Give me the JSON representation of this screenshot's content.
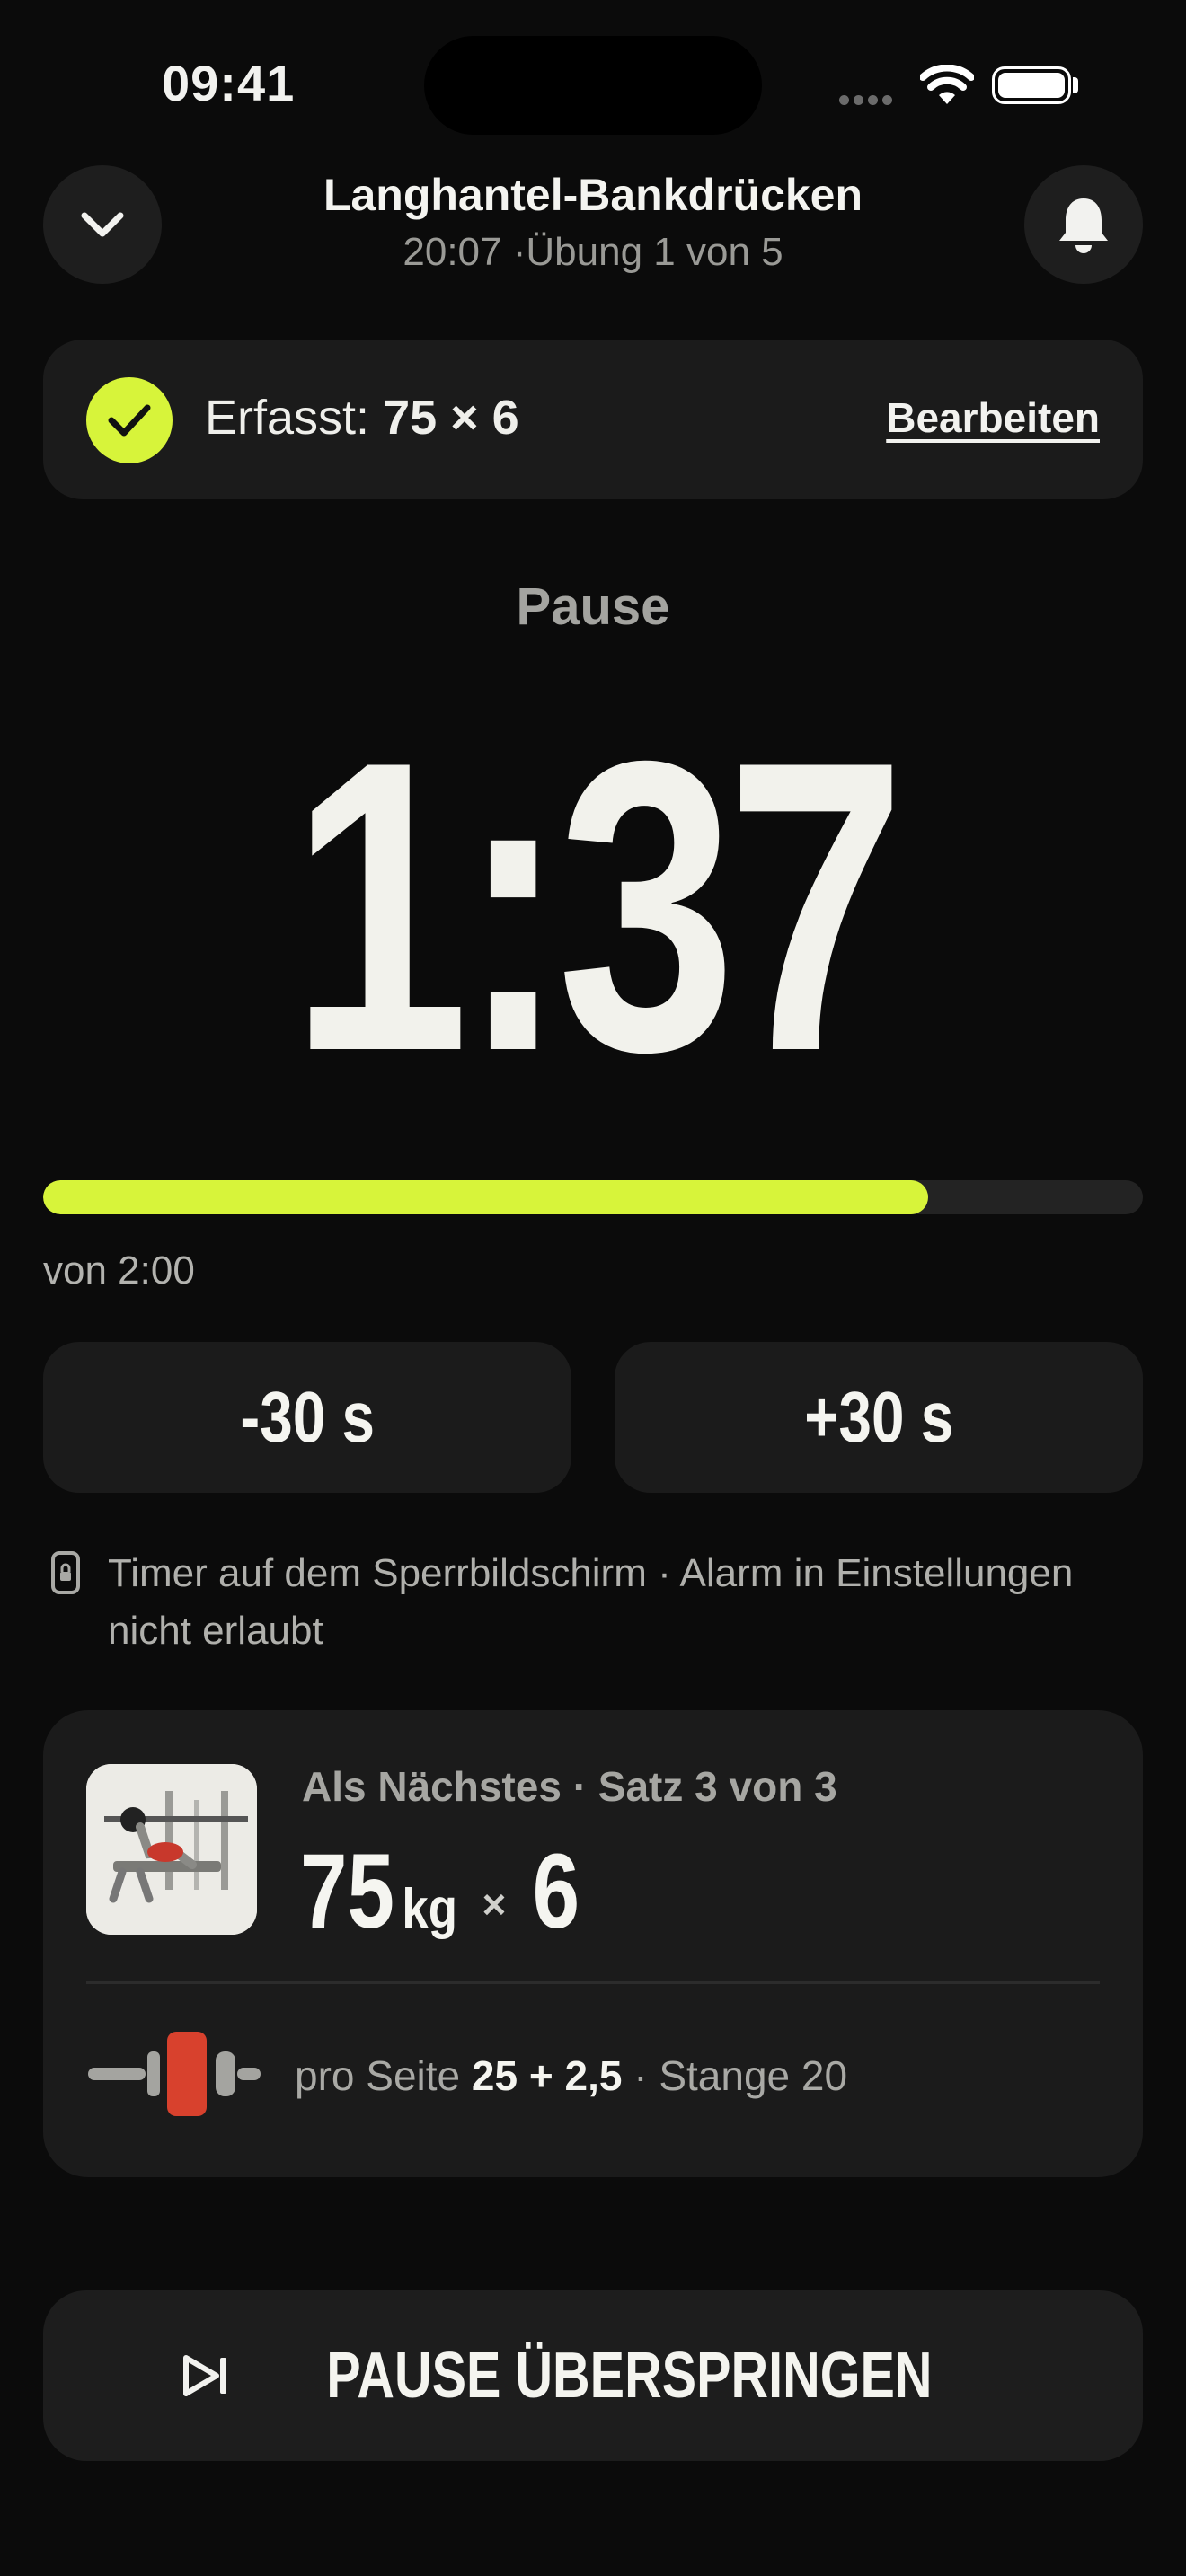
{
  "status_bar": {
    "time": "09:41"
  },
  "header": {
    "title": "Langhantel-Bankdrücken",
    "elapsed": "20:07",
    "exercise_progress": "Übung 1 von 5"
  },
  "logged": {
    "prefix": "Erfasst:",
    "value": "75 × 6",
    "edit_label": "Bearbeiten",
    "check_color": "#d7f43a"
  },
  "rest": {
    "label": "Pause",
    "remaining": "1:37",
    "progress_fraction": 0.805,
    "of_label": "von 2:00",
    "minus_label": "-30 s",
    "plus_label": "+30 s",
    "lock_info": "Timer auf dem Sperrbildschirm · Alarm in Einstellungen nicht erlaubt",
    "accent": "#d7f43a"
  },
  "next_set": {
    "heading": "Als Nächstes · Satz 3 von 3",
    "weight": "75",
    "unit": "kg",
    "times": "×",
    "reps": "6",
    "plates_prefix": "pro Seite",
    "plates_value": "25 + 2,5",
    "bar_info": "· Stange 20",
    "plate_color": "#d8412d"
  },
  "skip_button": {
    "label": "PAUSE ÜBERSPRINGEN"
  },
  "icons": [
    "chevron-down-icon",
    "bell-icon",
    "checkmark-icon",
    "lock-icon",
    "barbell-icon",
    "skip-forward-icon"
  ]
}
